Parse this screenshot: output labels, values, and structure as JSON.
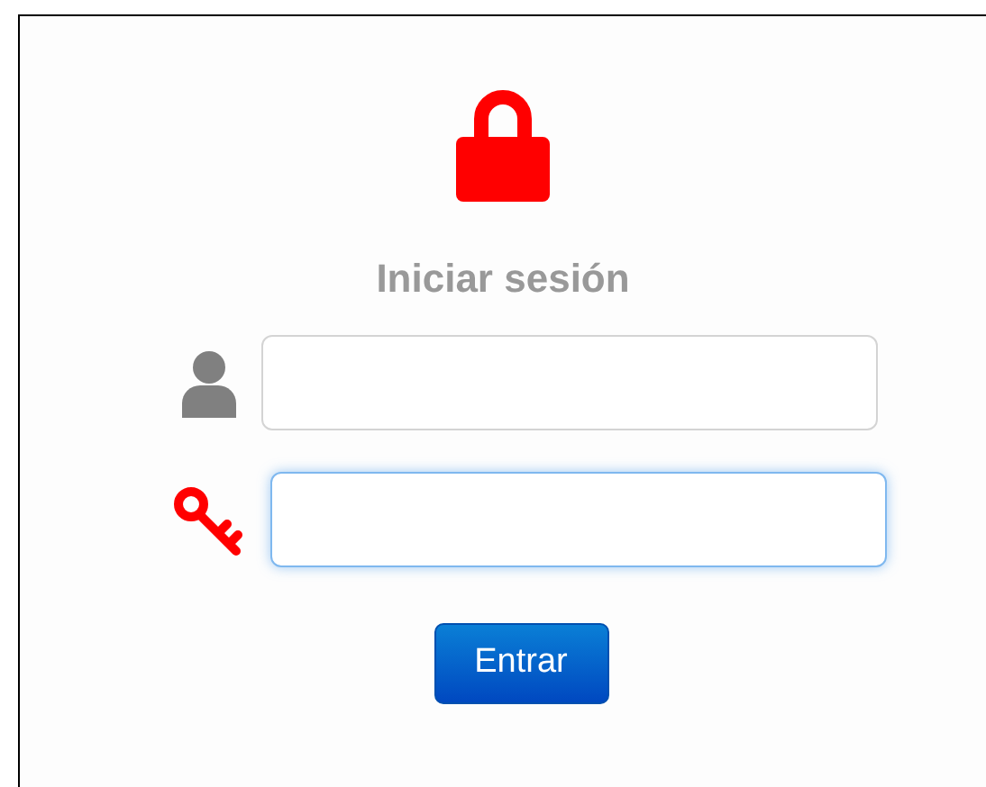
{
  "title": "Iniciar sesión",
  "fields": [
    {
      "kind": "user",
      "focused": false
    },
    {
      "kind": "password",
      "focused": true
    }
  ],
  "button": "Entrar"
}
